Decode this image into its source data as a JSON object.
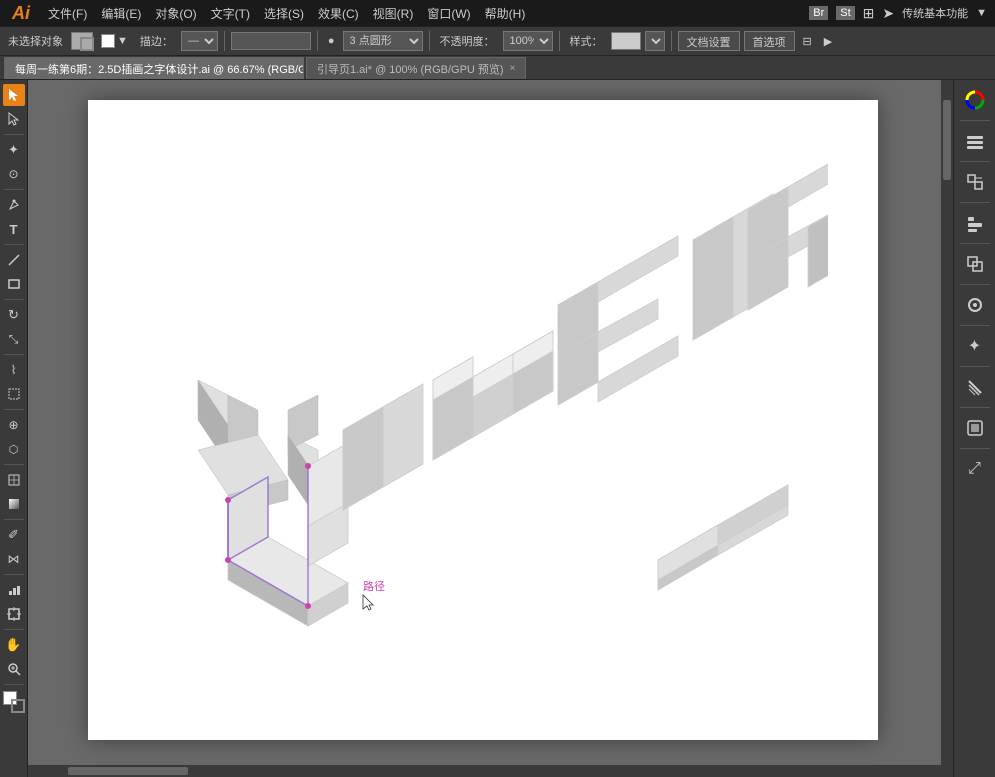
{
  "app": {
    "logo": "Ai",
    "title": "传统基本功能"
  },
  "menu": {
    "items": [
      "文件(F)",
      "编辑(E)",
      "对象(O)",
      "文字(T)",
      "选择(S)",
      "效果(C)",
      "视图(R)",
      "窗口(W)",
      "帮助(H)"
    ]
  },
  "toolbar": {
    "no_selection": "未选择对象",
    "stroke_label": "描边：",
    "point_type": "3 点圆形",
    "opacity_label": "不透明度：",
    "opacity_value": "100%",
    "style_label": "样式：",
    "doc_settings": "文档设置",
    "preferences": "首选项"
  },
  "tabs": [
    {
      "label": "每周一练第6期：2.5D插画之字体设计.ai @ 66.67% (RGB/GPU 预览)",
      "active": true,
      "closable": true
    },
    {
      "label": "引导页1.ai* @ 100% (RGB/GPU 预览)",
      "active": false,
      "closable": true
    }
  ],
  "tools": {
    "left": [
      {
        "name": "selection-tool",
        "icon": "▲",
        "active": true
      },
      {
        "name": "direct-selection-tool",
        "icon": "↖"
      },
      {
        "name": "magic-wand-tool",
        "icon": "✦"
      },
      {
        "name": "lasso-tool",
        "icon": "⊙"
      },
      {
        "name": "pen-tool",
        "icon": "✒"
      },
      {
        "name": "type-tool",
        "icon": "T"
      },
      {
        "name": "line-tool",
        "icon": "╲"
      },
      {
        "name": "rectangle-tool",
        "icon": "□"
      },
      {
        "name": "rotate-tool",
        "icon": "↻"
      },
      {
        "name": "reflect-tool",
        "icon": "⊷"
      },
      {
        "name": "scale-tool",
        "icon": "⤡"
      },
      {
        "name": "warp-tool",
        "icon": "⌇"
      },
      {
        "name": "width-tool",
        "icon": "⊣"
      },
      {
        "name": "free-transform-tool",
        "icon": "⊞"
      },
      {
        "name": "shape-builder-tool",
        "icon": "⊕"
      },
      {
        "name": "perspective-tool",
        "icon": "⬡"
      },
      {
        "name": "mesh-tool",
        "icon": "⊠"
      },
      {
        "name": "gradient-tool",
        "icon": "◫"
      },
      {
        "name": "eyedropper-tool",
        "icon": "✐"
      },
      {
        "name": "blend-tool",
        "icon": "⋈"
      },
      {
        "name": "symbol-tool",
        "icon": "⊛"
      },
      {
        "name": "bar-graph-tool",
        "icon": "▦"
      },
      {
        "name": "artboard-tool",
        "icon": "⊡"
      },
      {
        "name": "slice-tool",
        "icon": "⌗"
      },
      {
        "name": "eraser-tool",
        "icon": "◻"
      },
      {
        "name": "scissors-tool",
        "icon": "✂"
      },
      {
        "name": "hand-tool",
        "icon": "✋"
      },
      {
        "name": "zoom-tool",
        "icon": "🔍"
      }
    ]
  },
  "canvas": {
    "artboard_note": "white artboard with isometric 3D text UIMEIR"
  },
  "path_label": "路径",
  "right_panel": {
    "buttons": [
      "🎨",
      "◱",
      "⊞",
      "≡",
      "◻",
      "✦",
      "⋮⋮",
      "◉",
      "☰",
      "◱",
      "⤢"
    ]
  }
}
